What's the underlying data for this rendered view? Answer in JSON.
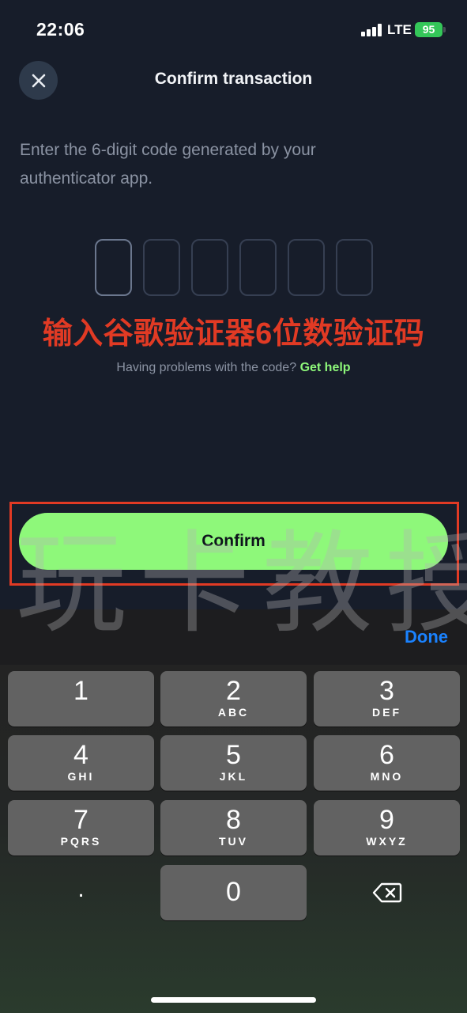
{
  "status_bar": {
    "time": "22:06",
    "network": "LTE",
    "battery": "95"
  },
  "header": {
    "close_icon": "close-icon",
    "title": "Confirm transaction"
  },
  "instructions": "Enter the 6-digit code generated by your authenticator app.",
  "code_input": {
    "digits": 6,
    "active_index": 0
  },
  "annotation": "输入谷歌验证器6位数验证码",
  "help": {
    "question": "Having problems with the code?",
    "link": "Get help"
  },
  "confirm_button": "Confirm",
  "watermark": "玩卡教授",
  "keyboard": {
    "done": "Done",
    "keys": [
      {
        "num": "1",
        "letters": ""
      },
      {
        "num": "2",
        "letters": "ABC"
      },
      {
        "num": "3",
        "letters": "DEF"
      },
      {
        "num": "4",
        "letters": "GHI"
      },
      {
        "num": "5",
        "letters": "JKL"
      },
      {
        "num": "6",
        "letters": "MNO"
      },
      {
        "num": "7",
        "letters": "PQRS"
      },
      {
        "num": "8",
        "letters": "TUV"
      },
      {
        "num": "9",
        "letters": "WXYZ"
      },
      {
        "num": "0",
        "letters": ""
      }
    ],
    "dot": ".",
    "backspace_icon": "backspace-icon"
  },
  "colors": {
    "accent": "#8ef87a",
    "background": "#171d2a",
    "annotation": "#e13a24",
    "done": "#1a82ff"
  }
}
